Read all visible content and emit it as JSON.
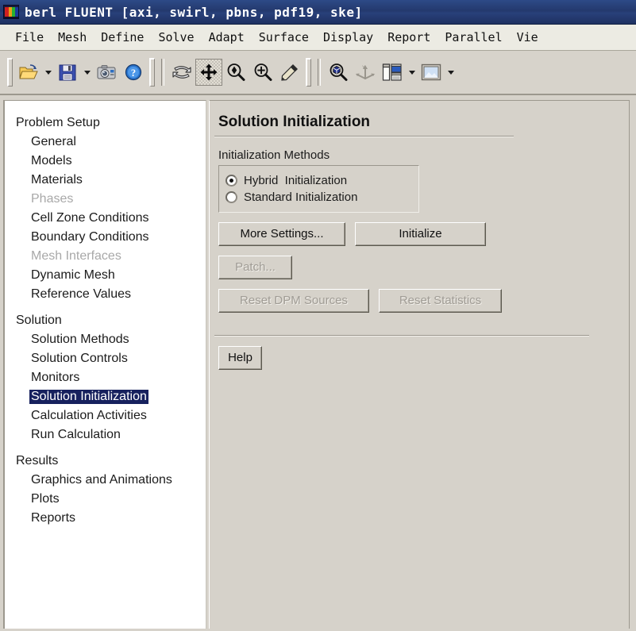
{
  "window": {
    "title": "berl FLUENT  [axi,  swirl,  pbns,  pdf19,  ske]",
    "icon": "fluent-contour-icon",
    "titlebar_color": "#27406f"
  },
  "menubar": {
    "items": [
      {
        "label": "File"
      },
      {
        "label": "Mesh"
      },
      {
        "label": "Define"
      },
      {
        "label": "Solve"
      },
      {
        "label": "Adapt"
      },
      {
        "label": "Surface"
      },
      {
        "label": "Display"
      },
      {
        "label": "Report"
      },
      {
        "label": "Parallel"
      },
      {
        "label": "Vie"
      }
    ]
  },
  "toolbar": {
    "buttons": [
      {
        "name": "open-file-icon",
        "tip": "Read File"
      },
      {
        "name": "open-file-dropdown",
        "tip": "Read"
      },
      {
        "name": "save-file-icon",
        "tip": "Write File"
      },
      {
        "name": "save-file-dropdown",
        "tip": "Write"
      },
      {
        "name": "camera-icon",
        "tip": "Save Picture"
      },
      {
        "name": "help-icon",
        "tip": "Help"
      },
      {
        "name": "reset-view-icon",
        "tip": "Reset"
      },
      {
        "name": "pan-icon",
        "tip": "Pan",
        "state": "pressed"
      },
      {
        "name": "zoom-out-icon",
        "tip": "Zoom Out"
      },
      {
        "name": "zoom-in-icon",
        "tip": "Zoom In"
      },
      {
        "name": "probe-icon",
        "tip": "Probe"
      },
      {
        "name": "fit-to-window-icon",
        "tip": "Fit to Window"
      },
      {
        "name": "axes-icon",
        "tip": "Axes"
      },
      {
        "name": "layout-icon",
        "tip": "Layout"
      },
      {
        "name": "layout-dropdown",
        "tip": "Layout Options"
      },
      {
        "name": "viewport-icon",
        "tip": "Viewport"
      },
      {
        "name": "viewport-dropdown",
        "tip": "Viewport Options"
      }
    ]
  },
  "sidebar": {
    "sections": [
      {
        "group": "Problem Setup",
        "items": [
          {
            "label": "General",
            "state": "normal"
          },
          {
            "label": "Models",
            "state": "normal"
          },
          {
            "label": "Materials",
            "state": "normal"
          },
          {
            "label": "Phases",
            "state": "disabled"
          },
          {
            "label": "Cell Zone Conditions",
            "state": "normal"
          },
          {
            "label": "Boundary Conditions",
            "state": "normal"
          },
          {
            "label": "Mesh Interfaces",
            "state": "disabled"
          },
          {
            "label": "Dynamic Mesh",
            "state": "normal"
          },
          {
            "label": "Reference Values",
            "state": "normal"
          }
        ]
      },
      {
        "group": "Solution",
        "items": [
          {
            "label": "Solution Methods",
            "state": "normal"
          },
          {
            "label": "Solution Controls",
            "state": "normal"
          },
          {
            "label": "Monitors",
            "state": "normal"
          },
          {
            "label": "Solution Initialization",
            "state": "selected"
          },
          {
            "label": "Calculation Activities",
            "state": "normal"
          },
          {
            "label": "Run Calculation",
            "state": "normal"
          }
        ]
      },
      {
        "group": "Results",
        "items": [
          {
            "label": "Graphics and Animations",
            "state": "normal"
          },
          {
            "label": "Plots",
            "state": "normal"
          },
          {
            "label": "Reports",
            "state": "normal"
          }
        ]
      }
    ],
    "selection_color": "#17215e"
  },
  "panel": {
    "title": "Solution Initialization",
    "methods_label": "Initialization Methods",
    "methods": [
      {
        "label": "Hybrid  Initialization",
        "selected": true
      },
      {
        "label": "Standard Initialization",
        "selected": false
      }
    ],
    "buttons": {
      "more_settings": "More Settings...",
      "initialize": "Initialize",
      "patch": "Patch...",
      "reset_dpm_sources": "Reset DPM Sources",
      "reset_statistics": "Reset Statistics",
      "help": "Help"
    }
  }
}
